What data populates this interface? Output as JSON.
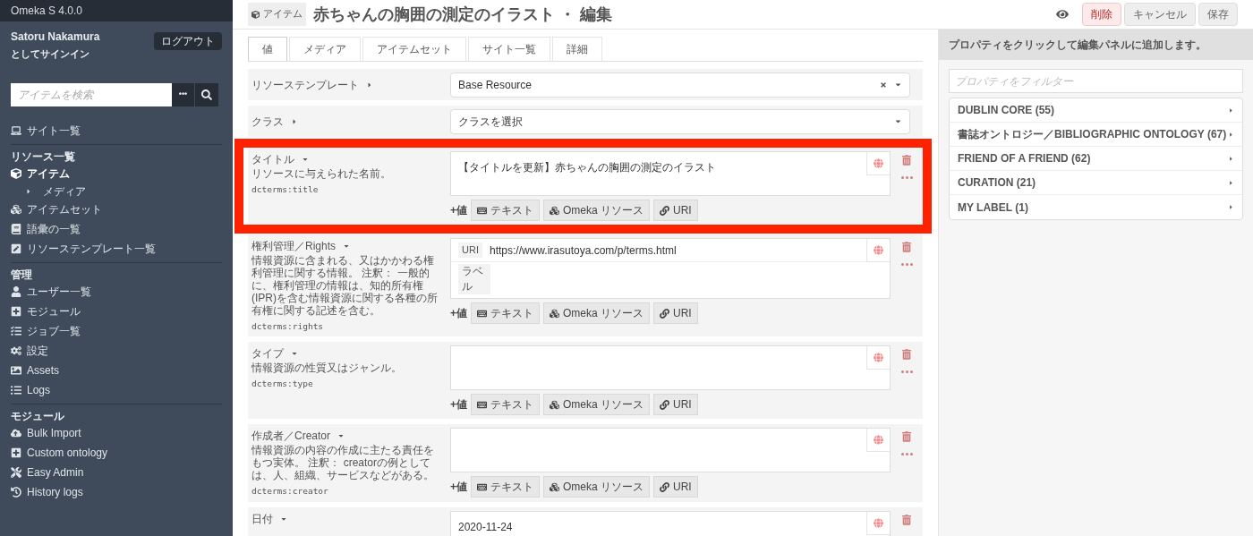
{
  "app": {
    "version": "Omeka S 4.0.0"
  },
  "user": {
    "name": "Satoru Nakamura",
    "signed_in_as": "としてサインイン",
    "logout": "ログアウト"
  },
  "search": {
    "placeholder": "アイテムを検索",
    "more": "•••"
  },
  "nav": [
    {
      "items": [
        {
          "label": "サイト一覧",
          "selected": false
        }
      ]
    },
    {
      "heading": "リソース一覧",
      "items": [
        {
          "label": "アイテム",
          "selected": true,
          "children": [
            {
              "label": "メディア",
              "selected": false
            }
          ]
        },
        {
          "label": "アイテムセット",
          "selected": false
        },
        {
          "label": "語彙の一覧",
          "selected": false
        },
        {
          "label": "リソーステンプレート一覧",
          "selected": false
        }
      ]
    },
    {
      "heading": "管理",
      "items": [
        {
          "label": "ユーザー一覧",
          "selected": false
        },
        {
          "label": "モジュール",
          "selected": false
        },
        {
          "label": "ジョブ一覧",
          "selected": false
        },
        {
          "label": "設定",
          "selected": false
        },
        {
          "label": "Assets",
          "selected": false
        },
        {
          "label": "Logs",
          "selected": false
        }
      ]
    },
    {
      "heading": "モジュール",
      "items": [
        {
          "label": "Bulk Import",
          "selected": false
        },
        {
          "label": "Custom ontology",
          "selected": false
        },
        {
          "label": "Easy Admin",
          "selected": false
        },
        {
          "label": "History logs",
          "selected": false
        }
      ]
    }
  ],
  "header": {
    "badge": "アイテム",
    "title": "赤ちゃんの胸囲の測定のイラスト ・ 編集",
    "buttons": [
      {
        "label": "削除",
        "kind": "danger"
      },
      {
        "label": "キャンセル",
        "kind": "plain"
      },
      {
        "label": "保存",
        "kind": "plain"
      }
    ]
  },
  "tabs": [
    {
      "label": "値",
      "selected": true
    },
    {
      "label": "メディア",
      "selected": false
    },
    {
      "label": "アイテムセット",
      "selected": false
    },
    {
      "label": "サイト一覧",
      "selected": false
    },
    {
      "label": "詳細",
      "selected": false
    }
  ],
  "selects": [
    {
      "label": "リソーステンプレート",
      "value": "Base Resource",
      "clearable": true
    },
    {
      "label": "クラス",
      "value": "クラスを選択",
      "clearable": false
    }
  ],
  "properties": [
    {
      "label": "タイトル",
      "description": "リソースに与えられた名前。",
      "term": "dcterms:title",
      "highlighted": true,
      "value": {
        "kind": "literal",
        "text": "【タイトルを更新】赤ちゃんの胸囲の測定のイラスト"
      },
      "add": "+値",
      "buttons": [
        "テキスト",
        "Omeka リソース",
        "URI"
      ]
    },
    {
      "label": "権利管理／Rights",
      "description": "情報資源に含まれる、又はかかわる権利管理に関する情報。 注釈： 一般的に、権利管理の情報は、知的所有権(IPR)を含む情報資源に関する各種の所有権に関する記述を含む。",
      "term": "dcterms:rights",
      "highlighted": false,
      "value": {
        "kind": "uri",
        "uri_label": "URI",
        "text": "https://www.irasutoya.com/p/terms.html",
        "label_label": "ラベル"
      },
      "add": "+値",
      "buttons": [
        "テキスト",
        "Omeka リソース",
        "URI"
      ]
    },
    {
      "label": "タイプ",
      "description": "情報資源の性質又はジャンル。",
      "term": "dcterms:type",
      "highlighted": false,
      "value": {
        "kind": "literal"
      },
      "add": "+値",
      "buttons": [
        "テキスト",
        "Omeka リソース",
        "URI"
      ]
    },
    {
      "label": "作成者／Creator",
      "description": "情報資源の内容の作成に主たる責任をもつ実体。 注釈： creatorの例としては、人、組織、サービスなどがある。",
      "term": "dcterms:creator",
      "highlighted": false,
      "value": {
        "kind": "literal"
      },
      "add": "+値",
      "buttons": [
        "テキスト",
        "Omeka リソース",
        "URI"
      ]
    },
    {
      "label": "日付",
      "highlighted": false,
      "value": {
        "kind": "literal",
        "text": "2020-11-24"
      }
    }
  ],
  "panel": {
    "hint": "プロパティをクリックして編集パネルに追加します。",
    "filter_placeholder": "プロパティをフィルター",
    "vocabularies": [
      {
        "label": "DUBLIN CORE (55)",
        "expanded": false
      },
      {
        "label": "書誌オントロジー／BIBLIOGRAPHIC ONTOLOGY (67)",
        "expanded": false
      },
      {
        "label": "FRIEND OF A FRIEND (62)",
        "expanded": false
      },
      {
        "label": "CURATION (21)",
        "expanded": false
      },
      {
        "label": "MY LABEL (1)",
        "expanded": false
      }
    ]
  }
}
